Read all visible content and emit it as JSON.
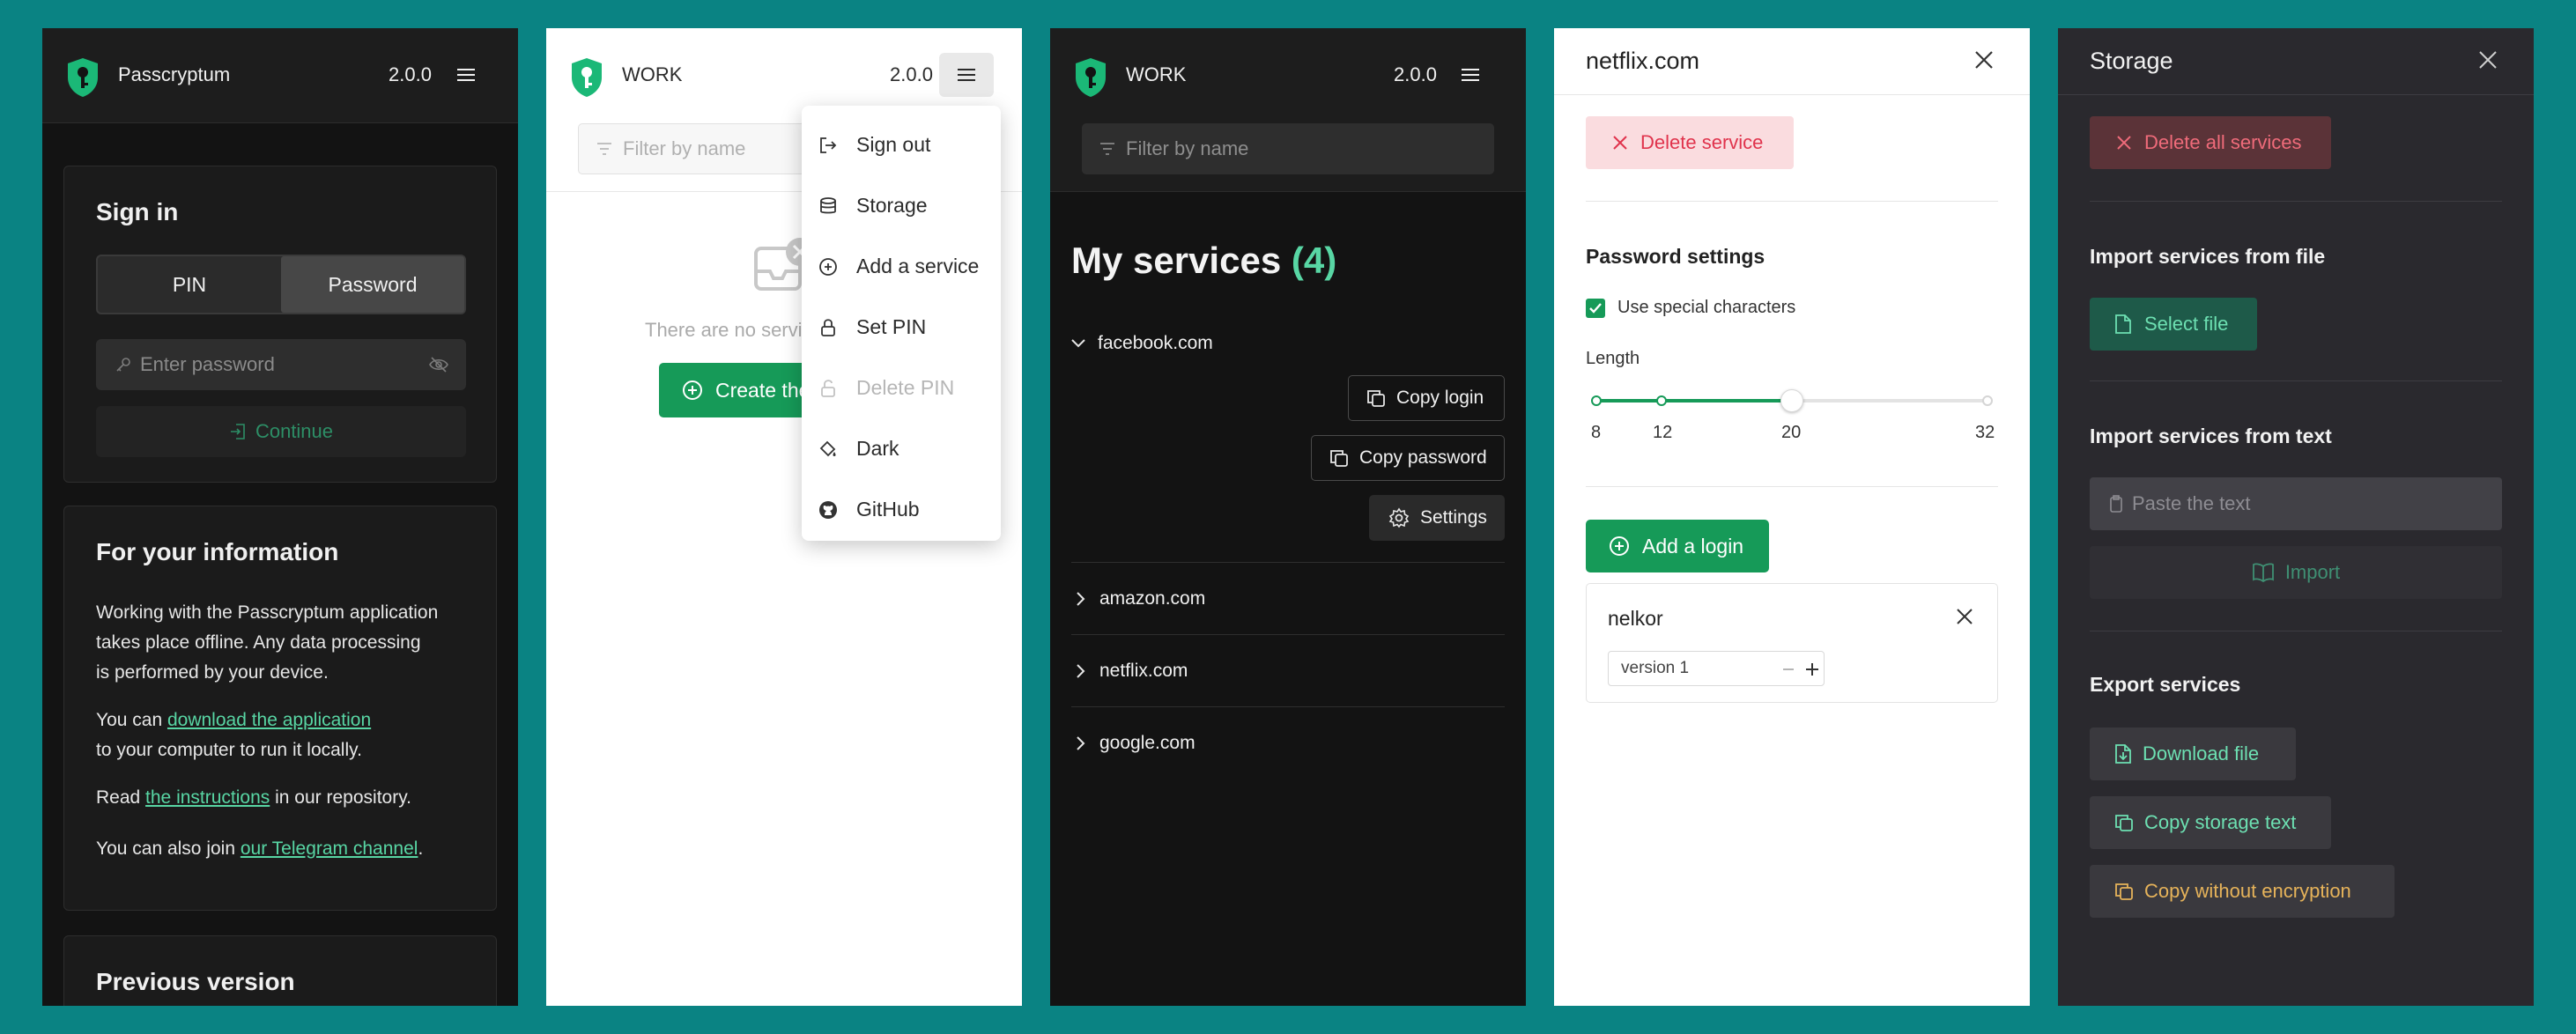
{
  "colors": {
    "background": "#0a8383",
    "brand_green": "#169a58",
    "accent_green": "#58d6a4",
    "danger": "#e0334c",
    "warning": "#e6b35a"
  },
  "app": {
    "name": "Passcryptum",
    "version": "2.0.0",
    "profile": "WORK"
  },
  "signin": {
    "title": "Sign in",
    "tabs": [
      "PIN",
      "Password"
    ],
    "active_tab": "Password",
    "password_placeholder": "Enter password",
    "continue_label": "Continue"
  },
  "info": {
    "title": "For your information",
    "p1_lines": [
      "Working with the Passcryptum application",
      "takes place offline. Any data processing",
      "is performed by your device."
    ],
    "p2_prefix": "You can ",
    "p2_link": "download the application",
    "p2_suffix": "to your computer to run it locally.",
    "p3_prefix": "Read ",
    "p3_link": "the instructions",
    "p3_suffix": " in our repository.",
    "p4_prefix": "You can also join ",
    "p4_link": "our Telegram channel",
    "p4_suffix": "."
  },
  "previous": {
    "title": "Previous version"
  },
  "empty_state": {
    "filter_placeholder": "Filter by name",
    "message": "There are no servi",
    "create_label": "Create the"
  },
  "menu": {
    "items": [
      {
        "label": "Sign out",
        "icon": "sign-out-icon",
        "disabled": false
      },
      {
        "label": "Storage",
        "icon": "database-icon",
        "disabled": false
      },
      {
        "label": "Add a service",
        "icon": "plus-circle-icon",
        "disabled": false
      },
      {
        "label": "Set PIN",
        "icon": "lock-icon",
        "disabled": false
      },
      {
        "label": "Delete PIN",
        "icon": "unlock-icon",
        "disabled": true
      },
      {
        "label": "Dark",
        "icon": "paint-bucket-icon",
        "disabled": false
      },
      {
        "label": "GitHub",
        "icon": "github-icon",
        "disabled": false
      }
    ]
  },
  "services": {
    "filter_placeholder": "Filter by name",
    "heading": "My services",
    "count": "(4)",
    "expanded": "facebook.com",
    "copy_login": "Copy login",
    "copy_password": "Copy password",
    "settings": "Settings",
    "others": [
      "amazon.com",
      "netflix.com",
      "google.com"
    ]
  },
  "service_settings": {
    "title": "netflix.com",
    "delete_label": "Delete service",
    "password_settings": "Password settings",
    "special_chars": "Use special characters",
    "special_chars_checked": true,
    "length_label": "Length",
    "length_ticks": [
      "8",
      "12",
      "20",
      "32"
    ],
    "length_value": 20,
    "add_login": "Add a login",
    "login_name": "nelkor",
    "version_value": "version 1"
  },
  "storage": {
    "title": "Storage",
    "delete_all": "Delete all services",
    "import_file_title": "Import services from file",
    "select_file": "Select file",
    "import_text_title": "Import services from text",
    "paste_placeholder": "Paste the text",
    "import_label": "Import",
    "export_title": "Export services",
    "download_file": "Download file",
    "copy_storage": "Copy storage text",
    "copy_without_enc": "Copy without encryption"
  }
}
